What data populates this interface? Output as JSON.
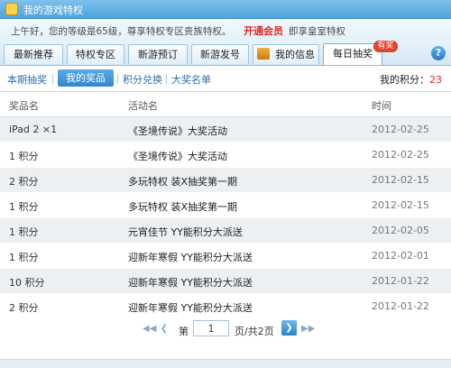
{
  "window": {
    "title": "我的游戏特权"
  },
  "greeting": {
    "text": "上午好，您的等级是65级，尊享特权专区贵族特权。",
    "link": "开通会员",
    "suffix": "即享皇室特权"
  },
  "tabs": [
    {
      "label": "最新推荐"
    },
    {
      "label": "特权专区"
    },
    {
      "label": "新游预订"
    },
    {
      "label": "新游发号"
    },
    {
      "label": "我的信息"
    },
    {
      "label": "每日抽奖"
    }
  ],
  "hot_badge": "有奖",
  "help_label": "?",
  "subnav": {
    "items": [
      "本期抽奖",
      "我的奖品",
      "积分兑换",
      "大奖名单"
    ],
    "points_label": "我的积分：",
    "points_value": "23"
  },
  "table": {
    "headers": [
      "奖品名",
      "活动名",
      "时间"
    ],
    "rows": [
      {
        "prize": "iPad 2 ×1",
        "activity": "《圣境传说》大奖活动",
        "time": "2012-02-25"
      },
      {
        "prize": "1 积分",
        "activity": "《圣境传说》大奖活动",
        "time": "2012-02-25"
      },
      {
        "prize": "2 积分",
        "activity": "多玩特权 装X抽奖第一期",
        "time": "2012-02-15"
      },
      {
        "prize": "1 积分",
        "activity": "多玩特权 装X抽奖第一期",
        "time": "2012-02-15"
      },
      {
        "prize": "1 积分",
        "activity": "元宵佳节 YY能积分大派送",
        "time": "2012-02-05"
      },
      {
        "prize": "1 积分",
        "activity": "迎新年寒假 YY能积分大派送",
        "time": "2012-02-01"
      },
      {
        "prize": "10 积分",
        "activity": "迎新年寒假 YY能积分大派送",
        "time": "2012-01-22"
      },
      {
        "prize": "2 积分",
        "activity": "迎新年寒假 YY能积分大派送",
        "time": "2012-01-22"
      }
    ]
  },
  "pager": {
    "prefix": "第",
    "page": "1",
    "suffix": "页/共2页"
  },
  "icons": {
    "first": "first-page-icon",
    "prev": "prev-page-icon",
    "next": "next-page-icon",
    "last": "last-page-icon"
  },
  "colors": {
    "accent": "#3086cf",
    "highlight": "#e3261b"
  }
}
